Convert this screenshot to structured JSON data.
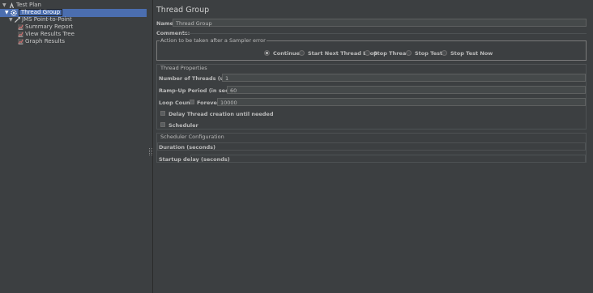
{
  "tree": {
    "items": [
      {
        "label": "Test Plan"
      },
      {
        "label": "Thread Group"
      },
      {
        "label": "JMS Point-to-Point"
      },
      {
        "label": "Summary Report"
      },
      {
        "label": "View Results Tree"
      },
      {
        "label": "Graph Results"
      }
    ]
  },
  "panel": {
    "title": "Thread Group",
    "name_label": "Name:",
    "name_value": "Thread Group",
    "comments_label": "Comments:",
    "sampler_error": {
      "title": "Action to be taken after a Sampler error",
      "options": [
        {
          "label": "Continue",
          "selected": true
        },
        {
          "label": "Start Next Thread Loop",
          "selected": false
        },
        {
          "label": "Stop Thread",
          "selected": false
        },
        {
          "label": "Stop Test",
          "selected": false
        },
        {
          "label": "Stop Test Now",
          "selected": false
        }
      ]
    },
    "thread_properties": {
      "title": "Thread Properties",
      "threads_label": "Number of Threads (users):",
      "threads_value": "1",
      "rampup_label": "Ramp-Up Period (in seconds):",
      "rampup_value": "60",
      "loop_label": "Loop Count:",
      "forever_label": "Forever",
      "loop_value": "10000",
      "delay_label": "Delay Thread creation until needed",
      "scheduler_label": "Scheduler"
    },
    "scheduler_config": {
      "title": "Scheduler Configuration",
      "duration_label": "Duration (seconds)",
      "duration_value": "",
      "startup_label": "Startup delay (seconds)",
      "startup_value": ""
    }
  }
}
